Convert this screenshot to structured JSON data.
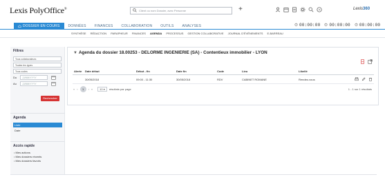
{
  "header": {
    "logo": "Lexis PolyOffice",
    "search_placeholder": "Client ou nom Dossier, avec Personne",
    "brand_right": {
      "a": "Lexis",
      "b": "360"
    }
  },
  "main_tabs": [
    {
      "label": "DOSSIER EN COURS",
      "active": true
    },
    {
      "label": "DONNÉES",
      "active": false
    },
    {
      "label": "FINANCES",
      "active": false
    },
    {
      "label": "COLLABORATION",
      "active": false
    },
    {
      "label": "OUTILS",
      "active": false
    },
    {
      "label": "ANALYSES",
      "active": false
    }
  ],
  "timers": [
    {
      "value": "00:00:00"
    },
    {
      "value": "00:00:00"
    },
    {
      "value": "00:00:00"
    }
  ],
  "sub_tabs": [
    {
      "label": "SYNTHÈSE",
      "active": false
    },
    {
      "label": "RÉDACTION",
      "active": false
    },
    {
      "label": "PARAPHEUR",
      "active": false
    },
    {
      "label": "FINANCES",
      "active": false
    },
    {
      "label": "AGENDA",
      "active": true
    },
    {
      "label": "PROCESSUS",
      "active": false
    },
    {
      "label": "GESTION COLLABORATIVE",
      "active": false
    },
    {
      "label": "JOURNAL D'ÉVÉNEMENTS",
      "active": false
    },
    {
      "label": "E-BARREAU",
      "active": false
    }
  ],
  "filters": {
    "title": "Filtres",
    "collaborators": "Tous collaborateurs",
    "types": "Toutes les types",
    "colors": "Tous codes",
    "from_label": "Du",
    "to_label": "Au",
    "date_placeholder": "JJ/MM/YYYY",
    "search_button": "Rechercher"
  },
  "agenda_panel": {
    "title": "Agenda",
    "items": [
      {
        "label": "Liste",
        "selected": true
      },
      {
        "label": "Date",
        "selected": false
      }
    ]
  },
  "quick_access": {
    "title": "Accès rapide",
    "items": [
      "Mes actions",
      "Mes dossiers récents",
      "Mes dossiers favoris"
    ]
  },
  "card": {
    "title": "Agenda du dossier 18.00253 - DELORME INGENIERIE (SA) - Contentieux immobilier - LYON",
    "columns": [
      "Alerte",
      "Date début",
      "Début - fin",
      "Date fin",
      "Code",
      "Lieu",
      "Libellé"
    ],
    "rows": [
      {
        "alert": "",
        "start_date": "30/05/2018",
        "time": "09:00 - 11:30",
        "end_date": "30/05/2018",
        "code": "RDV",
        "place": "CABINET ROMANE",
        "label": "Rendez-vous"
      }
    ],
    "pager": {
      "current_page": "1",
      "page_size": "10",
      "per_page_label": "résultats par page",
      "info": "1 - 1 sur 1 résultats"
    }
  },
  "colors": {
    "accent": "#2a8ad4",
    "button_red": "#d63333"
  }
}
